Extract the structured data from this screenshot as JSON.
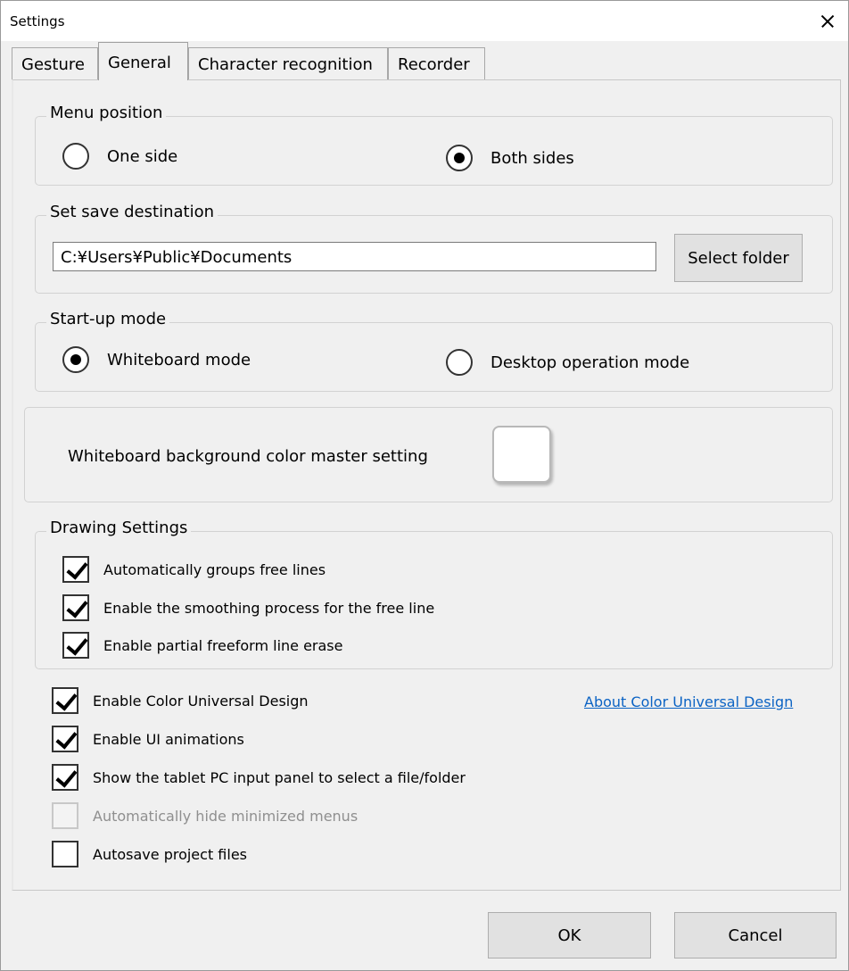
{
  "window": {
    "title": "Settings"
  },
  "tabs": [
    {
      "label": "Gesture"
    },
    {
      "label": "General"
    },
    {
      "label": "Character recognition"
    },
    {
      "label": "Recorder"
    }
  ],
  "menu_position": {
    "title": "Menu position",
    "options": [
      {
        "label": "One side",
        "selected": false
      },
      {
        "label": "Both sides",
        "selected": true
      }
    ]
  },
  "save_destination": {
    "title": "Set save destination",
    "path": "C:¥Users¥Public¥Documents",
    "button": "Select folder"
  },
  "startup_mode": {
    "title": "Start-up mode",
    "options": [
      {
        "label": "Whiteboard mode",
        "selected": true
      },
      {
        "label": "Desktop operation mode",
        "selected": false
      }
    ]
  },
  "whiteboard_bg": {
    "label": "Whiteboard background color master setting",
    "color": "#ffffff"
  },
  "drawing_settings": {
    "title": "Drawing Settings",
    "items": [
      {
        "label": "Automatically groups free lines",
        "checked": true
      },
      {
        "label": "Enable the smoothing process for the free line",
        "checked": true
      },
      {
        "label": "Enable partial freeform line erase",
        "checked": true
      }
    ]
  },
  "options": [
    {
      "label": "Enable Color Universal Design",
      "checked": true,
      "enabled": true
    },
    {
      "label": "Enable UI animations",
      "checked": true,
      "enabled": true
    },
    {
      "label": "Show the tablet PC input panel to select a file/folder",
      "checked": true,
      "enabled": true
    },
    {
      "label": "Automatically hide minimized menus",
      "checked": false,
      "enabled": false
    },
    {
      "label": "Autosave project files",
      "checked": false,
      "enabled": true
    }
  ],
  "about_link": "About Color Universal Design",
  "footer": {
    "ok": "OK",
    "cancel": "Cancel"
  }
}
